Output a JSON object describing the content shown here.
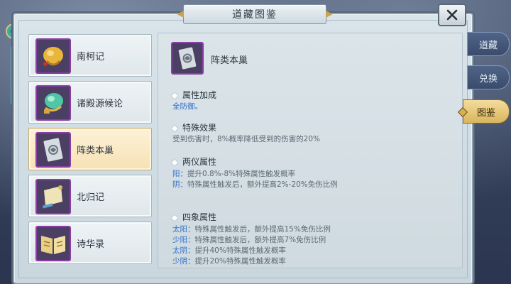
{
  "window": {
    "title": "道藏图鉴"
  },
  "list": {
    "items": [
      {
        "label": "南柯记",
        "icon": "golden-scroll-icon",
        "selected": false
      },
      {
        "label": "诸殿源候论",
        "icon": "jade-scroll-icon",
        "selected": false
      },
      {
        "label": "阵类本巢",
        "icon": "talisman-tablet-icon",
        "selected": true
      },
      {
        "label": "北归记",
        "icon": "paper-scroll-icon",
        "selected": false
      },
      {
        "label": "诗华录",
        "icon": "open-book-icon",
        "selected": false
      }
    ]
  },
  "detail": {
    "name": "阵类本巢",
    "attr_bonus": {
      "title": "属性加成",
      "value": "全防御。"
    },
    "special": {
      "title": "特殊效果",
      "text": "受到伤害时，8%概率降低受到的伤害的20%"
    },
    "liangyi": {
      "title": "两仪属性",
      "lines": [
        {
          "key": "阳：",
          "text": "提升0.8%-8%特殊属性触发概率"
        },
        {
          "key": "阴：",
          "text": "特殊属性触发后，额外提高2%-20%免伤比例"
        }
      ]
    },
    "sixiang": {
      "title": "四象属性",
      "lines": [
        {
          "key": "太阳：",
          "text": "特殊属性触发后，额外提高15%免伤比例"
        },
        {
          "key": "少阳：",
          "text": "特殊属性触发后，额外提高7%免伤比例"
        },
        {
          "key": "太阴：",
          "text": "提升40%特殊属性触发概率"
        },
        {
          "key": "少阴：",
          "text": "提升20%特殊属性触发概率"
        }
      ]
    }
  },
  "tabs": [
    {
      "label": "道藏",
      "active": false
    },
    {
      "label": "兑换",
      "active": false
    },
    {
      "label": "图鉴",
      "active": true
    }
  ],
  "colors": {
    "accent_blue": "#2e6fc9",
    "selected_bg": "#f6e1b4",
    "tab_active": "#d9b65e",
    "icon_border": "#8a3ea6"
  }
}
